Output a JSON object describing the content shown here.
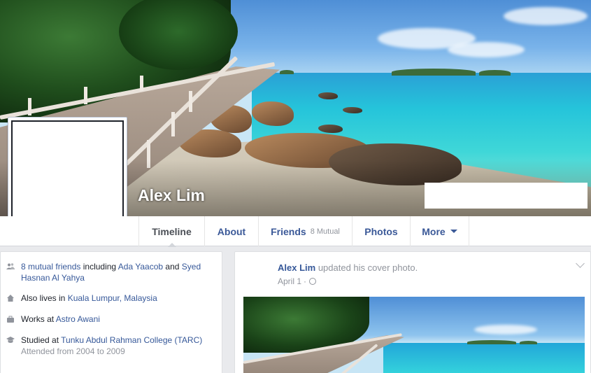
{
  "profile": {
    "name": "Alex Lim"
  },
  "nav": {
    "tabs": [
      {
        "label": "Timeline"
      },
      {
        "label": "About"
      },
      {
        "label": "Friends",
        "sub": "8 Mutual"
      },
      {
        "label": "Photos"
      },
      {
        "label": "More"
      }
    ]
  },
  "intro": {
    "mutual_friends_link": "8 mutual friends",
    "including": "including",
    "friend1": "Ada Yaacob",
    "and": "and",
    "friend2": "Syed Hasnan Al Yahya",
    "lives_prefix": "Also lives in",
    "lives_place": "Kuala Lumpur, Malaysia",
    "works_prefix": "Works at",
    "works_place": "Astro Awani",
    "studied_prefix": "Studied at",
    "studied_place": "Tunku Abdul Rahman College (TARC)",
    "attended": "Attended from 2004 to 2009"
  },
  "story": {
    "author": "Alex Lim",
    "action": "updated his cover photo.",
    "date": "April 1",
    "separator": "·"
  },
  "colors": {
    "link": "#365899",
    "muted": "#90949c",
    "background": "#e9eaed"
  }
}
